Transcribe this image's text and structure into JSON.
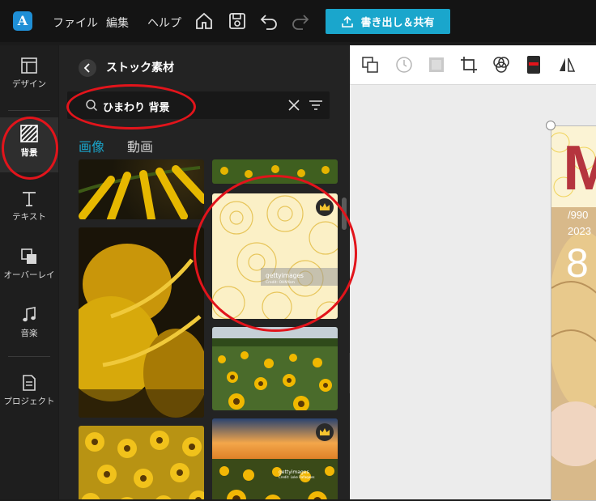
{
  "topbar": {
    "menus": [
      "ファイル",
      "編集",
      "ヘルプ"
    ],
    "export_label": "書き出し＆共有"
  },
  "sidebar": {
    "items": [
      {
        "label": "デザイン"
      },
      {
        "label": "背景"
      },
      {
        "label": "テキスト"
      },
      {
        "label": "オーバーレイ"
      },
      {
        "label": "音楽"
      },
      {
        "label": "プロジェクト"
      }
    ]
  },
  "panel": {
    "title": "ストック素材",
    "search_value": "ひまわり 背景",
    "tabs": [
      "画像",
      "動画"
    ],
    "thumbs": [
      {
        "watermark": ""
      },
      {
        "watermark": ""
      },
      {
        "watermark": "gettyimages",
        "credit": "Credit: OHNYam"
      },
      {
        "watermark": ""
      },
      {
        "watermark": ""
      },
      {
        "watermark": ""
      },
      {
        "watermark": "gettyimages",
        "credit": "Credit: Loke Rafaqwes"
      }
    ]
  },
  "canvas": {
    "title_letter": "M",
    "line1": "/990",
    "line2": "2023",
    "big_number": "8"
  },
  "colors": {
    "accent": "#1aa6cc",
    "annotation": "#e2141b"
  }
}
